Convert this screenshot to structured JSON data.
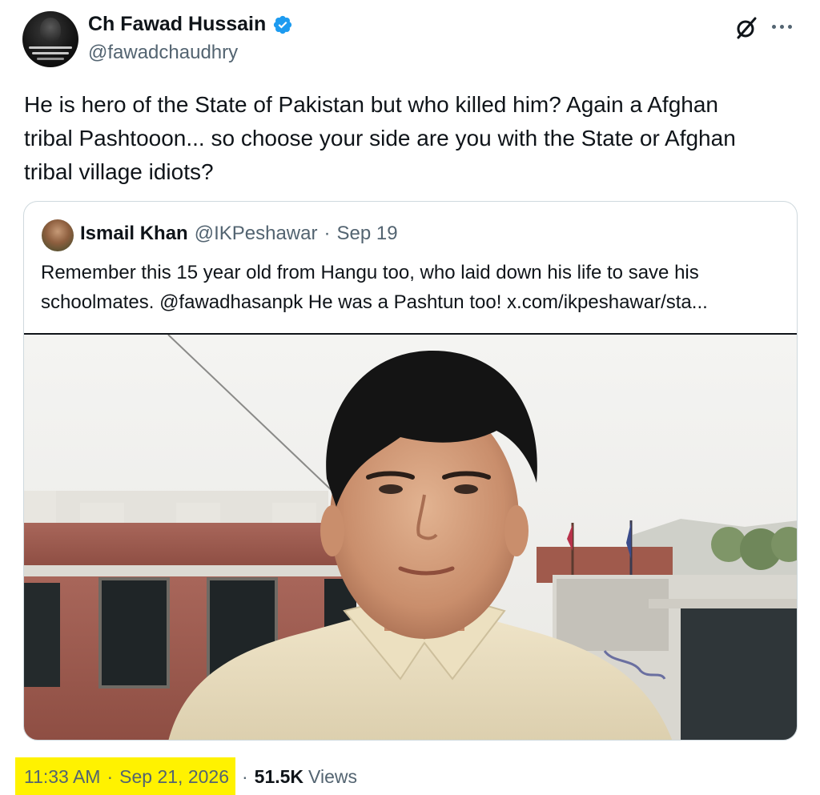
{
  "author": {
    "display_name": "Ch Fawad Hussain",
    "handle": "@fawadchaudhry",
    "verified": true,
    "avatar": "portrait-with-urdu-script"
  },
  "tweet": {
    "text": "He is hero of the State of Pakistan but who killed him? Again a Afghan\ntribal Pashtooon... so choose your side are you with the State or Afghan\ntribal village idiots?"
  },
  "quoted": {
    "display_name": "Ismail Khan",
    "handle": "@IKPeshawar",
    "separator": "·",
    "date": "Sep 19",
    "text": "Remember this 15 year old from Hangu too, who laid down his life to save his\nschoolmates. @fawadhasanpk He was a Pashtun too!  x.com/ikpeshawar/sta...",
    "media": "photo-teen-boy-in-front-of-school-building"
  },
  "meta": {
    "time": "11:33 AM",
    "separator": "·",
    "date": "Sep 21, 2026",
    "views_count": "51.5K",
    "views_label": "Views"
  },
  "icons": {
    "grok": "grok-icon",
    "more": "more-icon",
    "verified": "verified-badge-icon"
  },
  "colors": {
    "verified_blue": "#1d9bf0",
    "secondary_text": "#536471",
    "highlight": "#fff200"
  }
}
